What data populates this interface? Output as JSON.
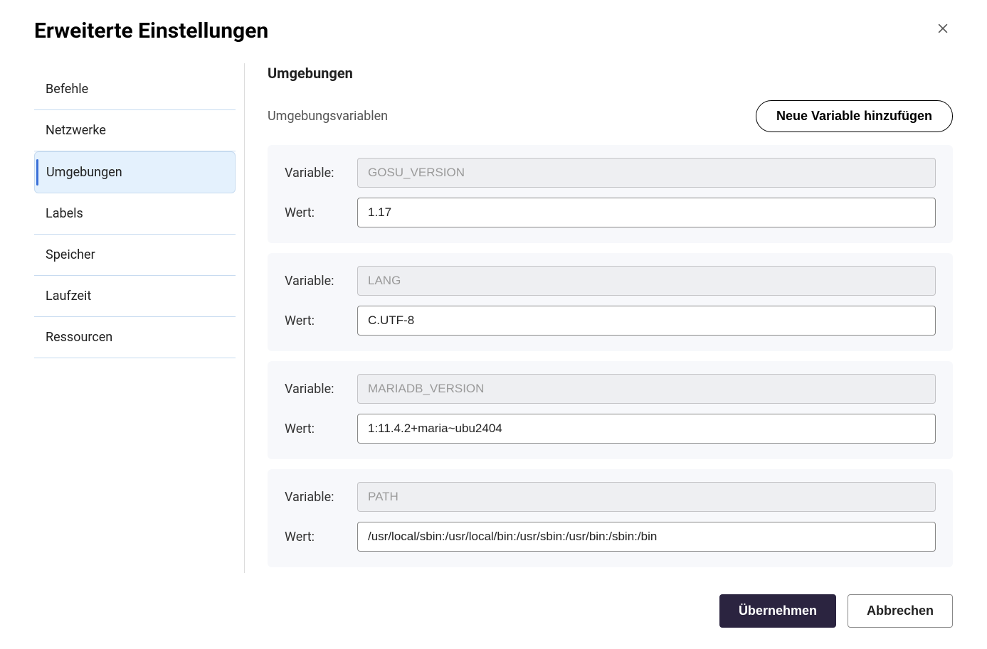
{
  "dialog": {
    "title": "Erweiterte Einstellungen"
  },
  "sidebar": {
    "items": [
      {
        "label": "Befehle",
        "selected": false
      },
      {
        "label": "Netzwerke",
        "selected": false
      },
      {
        "label": "Umgebungen",
        "selected": true
      },
      {
        "label": "Labels",
        "selected": false
      },
      {
        "label": "Speicher",
        "selected": false
      },
      {
        "label": "Laufzeit",
        "selected": false
      },
      {
        "label": "Ressourcen",
        "selected": false
      }
    ]
  },
  "main": {
    "title": "Umgebungen",
    "subtitle": "Umgebungsvariablen",
    "addButton": "Neue Variable hinzufügen",
    "rowLabels": {
      "variable": "Variable:",
      "value": "Wert:"
    },
    "envs": [
      {
        "name": "GOSU_VERSION",
        "value": "1.17"
      },
      {
        "name": "LANG",
        "value": "C.UTF-8"
      },
      {
        "name": "MARIADB_VERSION",
        "value": "1:11.4.2+maria~ubu2404"
      },
      {
        "name": "PATH",
        "value": "/usr/local/sbin:/usr/local/bin:/usr/sbin:/usr/bin:/sbin:/bin"
      }
    ]
  },
  "footer": {
    "apply": "Übernehmen",
    "cancel": "Abbrechen"
  }
}
